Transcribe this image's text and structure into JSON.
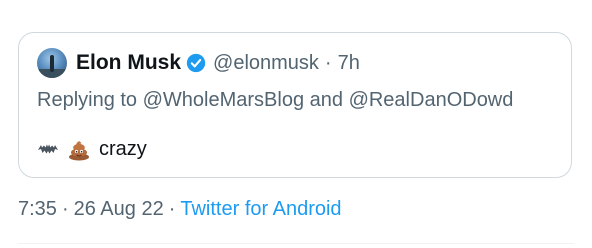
{
  "clipped_text": "••••••••••",
  "quote": {
    "author_name": "Elon Musk",
    "handle": "@elonmusk",
    "separator": "·",
    "age": "7h",
    "verified": true,
    "reply_text": "Replying to @WholeMarsBlog and @RealDanODowd",
    "body_icons": [
      "bat-emoji-icon",
      "pile-of-poo-emoji-icon"
    ],
    "body_text": "crazy"
  },
  "tweet_meta": {
    "time": "7:35",
    "separator": "·",
    "date": "26 Aug 22",
    "source": "Twitter for Android"
  },
  "colors": {
    "text_primary": "#0f1419",
    "text_secondary": "#536471",
    "link_blue": "#1d9bf0",
    "border": "#cfd9de"
  }
}
